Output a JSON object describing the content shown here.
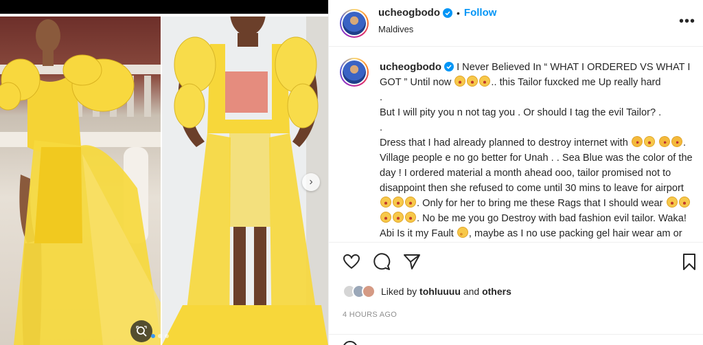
{
  "post": {
    "username": "ucheogbodo",
    "follow_label": "Follow",
    "bullet": "•",
    "location": "Maldives",
    "more_icon": "more-options-icon"
  },
  "caption": {
    "username": "ucheogbodo",
    "lines": [
      "I Never Believed In “ WHAT I ORDERED VS WHAT I GOT ” Until now",
      ".. this Tailor fuxcked me Up really hard",
      ".",
      "But I will pity you n not tag you . Or should I tag the evil Tailor? .",
      ".",
      "Dress that I had already planned to destroy internet with",
      ". Village people e no go better for Unah . . Sea Blue was the color of the day ! I ordered material a month ahead ooo, tailor promised not to disappoint then she refused to come until 30 mins to leave for airport",
      ". Only for her to bring me these Rags that I should wear",
      ". No be me you go Destroy with bad fashion evil tailor. Waka! Abi Is it my Fault",
      ", maybe as I no use packing gel hair wear am or As I take Stand ,"
    ]
  },
  "likes": {
    "prefix": "Liked by",
    "user": "tohluuuu",
    "and": "and",
    "others": "others"
  },
  "timestamp": "4 HOURS AGO",
  "carousel": {
    "count": 3,
    "active_index": 0
  },
  "colors": {
    "accent": "#0095f6",
    "verified": "#0095f6",
    "text": "#262626",
    "muted": "#8e8e8e",
    "dress_yellow": "#f7d73a"
  },
  "icons": [
    "like-icon",
    "comment-icon",
    "share-icon",
    "save-icon",
    "zoom-icon",
    "chevron-right-icon",
    "verified-icon"
  ]
}
